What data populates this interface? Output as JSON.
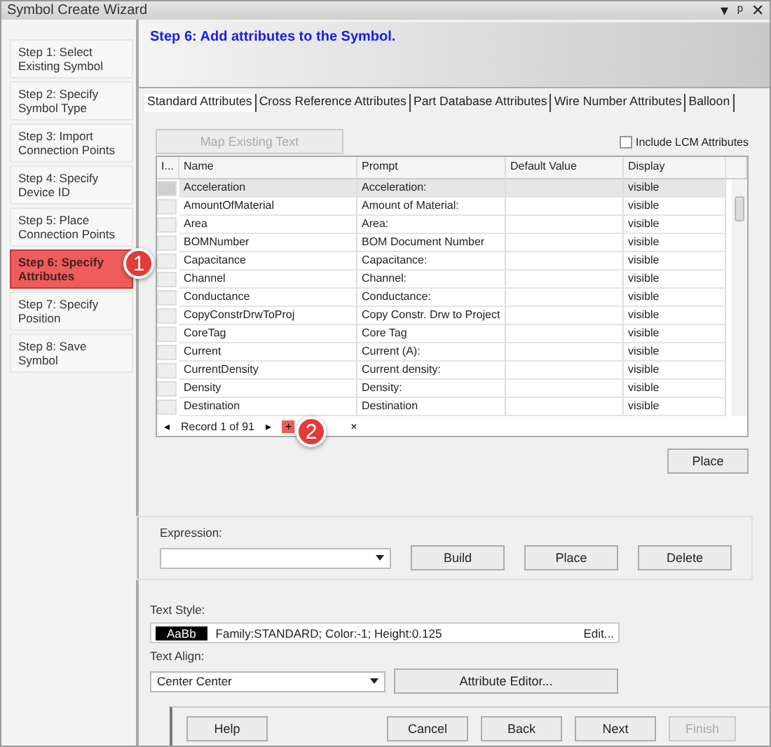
{
  "window": {
    "title": "Symbol Create Wizard",
    "controls": [
      "▾",
      "ᵖ",
      "✕"
    ]
  },
  "steps": [
    {
      "label": "Step 1: Select Existing Symbol",
      "selected": false
    },
    {
      "label": "Step 2: Specify Symbol Type",
      "selected": false
    },
    {
      "label": "Step 3: Import Connection Points",
      "selected": false
    },
    {
      "label": "Step 4: Specify Device ID",
      "selected": false
    },
    {
      "label": "Step 5: Place Connection Points",
      "selected": false
    },
    {
      "label": "Step 6: Specify Attributes",
      "selected": true
    },
    {
      "label": "Step 7: Specify Position",
      "selected": false
    },
    {
      "label": "Step 8: Save Symbol",
      "selected": false
    }
  ],
  "header": "Step 6: Add attributes to the Symbol.",
  "tabs": [
    {
      "label": "Standard Attributes",
      "selected": true
    },
    {
      "label": "Cross Reference Attributes",
      "selected": false
    },
    {
      "label": "Part Database Attributes",
      "selected": false
    },
    {
      "label": "Wire Number Attributes",
      "selected": false
    },
    {
      "label": "Balloon",
      "selected": false
    }
  ],
  "map_button": {
    "label": "Map Existing Text",
    "disabled": true
  },
  "include_lcm": {
    "label": "Include LCM Attributes",
    "checked": false
  },
  "table": {
    "columns": [
      "I...",
      "Name",
      "Prompt",
      "Default Value",
      "Display"
    ],
    "rows": [
      {
        "name": "Acceleration",
        "prompt": "Acceleration:",
        "display": "visible",
        "selected": true
      },
      {
        "name": "AmountOfMaterial",
        "prompt": "Amount of Material:",
        "display": "visible",
        "selected": false
      },
      {
        "name": "Area",
        "prompt": "Area:",
        "display": "visible",
        "selected": false
      },
      {
        "name": "BOMNumber",
        "prompt": "BOM Document Number",
        "display": "visible",
        "selected": false
      },
      {
        "name": "Capacitance",
        "prompt": "Capacitance:",
        "display": "visible",
        "selected": false
      },
      {
        "name": "Channel",
        "prompt": "Channel:",
        "display": "visible",
        "selected": false
      },
      {
        "name": "Conductance",
        "prompt": "Conductance:",
        "display": "visible",
        "selected": false
      },
      {
        "name": "CopyConstrDrwToProj",
        "prompt": "Copy Constr. Drw to Project",
        "display": "visible",
        "selected": false
      },
      {
        "name": "CoreTag",
        "prompt": "Core Tag",
        "display": "visible",
        "selected": false
      },
      {
        "name": "Current",
        "prompt": "Current (A):",
        "display": "visible",
        "selected": false
      },
      {
        "name": "CurrentDensity",
        "prompt": "Current density:",
        "display": "visible",
        "selected": false
      },
      {
        "name": "Density",
        "prompt": "Density:",
        "display": "visible",
        "selected": false
      },
      {
        "name": "Destination",
        "prompt": "Destination",
        "display": "visible",
        "selected": false
      }
    ]
  },
  "navigator": {
    "prev": "◂",
    "record": "Record 1 of 91",
    "next": "▸",
    "add": "+",
    "delete": "×",
    "add_highlighted": true
  },
  "callouts": [
    "1",
    "2"
  ],
  "place_button": "Place",
  "expression": {
    "label": "Expression:",
    "buttons": [
      "Build",
      "Place",
      "Delete"
    ]
  },
  "text_style": {
    "label": "Text Style:",
    "sample": "AaBb",
    "value": "Family:STANDARD; Color:-1; Height:0.125",
    "edit": "Edit..."
  },
  "text_align": {
    "label": "Text Align:",
    "value": "Center Center",
    "editor_button": "Attribute Editor..."
  },
  "footer": [
    {
      "label": "Help",
      "disabled": false
    },
    {
      "label": "Cancel",
      "disabled": false
    },
    {
      "label": "Back",
      "disabled": false
    },
    {
      "label": "Next",
      "disabled": false
    },
    {
      "label": "Finish",
      "disabled": true
    }
  ]
}
